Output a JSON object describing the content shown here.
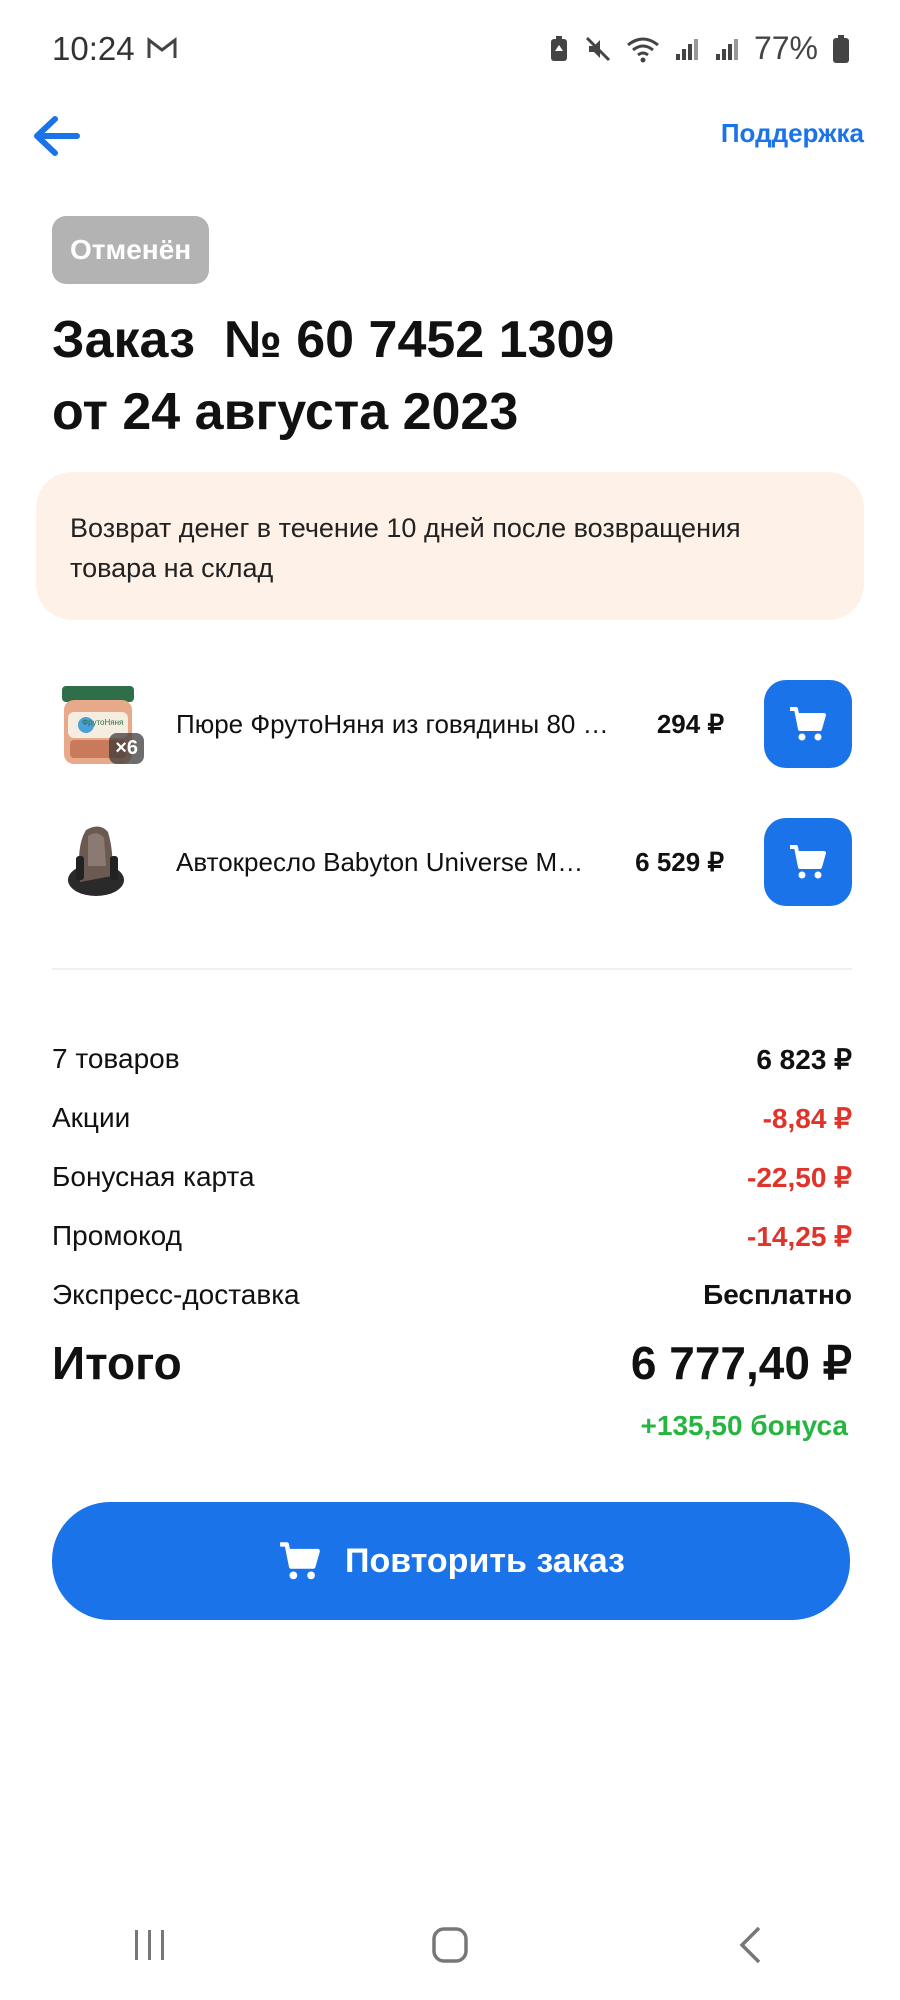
{
  "status_bar": {
    "time": "10:24",
    "battery": "77%"
  },
  "header": {
    "support_label": "Поддержка"
  },
  "order": {
    "status_badge": "Отменён",
    "title_line1": "Заказ  № 60 7452 1309",
    "title_line2": "от 24 августа 2023"
  },
  "banner": {
    "text": "Возврат денег в течение 10 дней после возвращения товара на склад"
  },
  "products": [
    {
      "name": "Пюре ФрутоНяня из говядины 80 …",
      "price": "294 ₽",
      "quantity_badge": "×6",
      "thumb_label": "ФрутоНяня"
    },
    {
      "name": "Автокресло Babyton Universe M…",
      "price": "6 529 ₽"
    }
  ],
  "summary": {
    "rows": [
      {
        "label": "7 товаров",
        "value": "6 823 ₽"
      },
      {
        "label": "Акции",
        "value": "-8,84 ₽"
      },
      {
        "label": "Бонусная карта",
        "value": "-22,50 ₽"
      },
      {
        "label": "Промокод",
        "value": "-14,25 ₽"
      },
      {
        "label": "Экспресс-доставка",
        "value": "Бесплатно"
      }
    ],
    "total_label": "Итого",
    "total_value": "6 777,40 ₽",
    "bonus": "+135,50 бонуса"
  },
  "actions": {
    "repeat_label": "Повторить заказ"
  },
  "colors": {
    "accent": "#1a73e8",
    "negative": "#e0332a",
    "bonus": "#27b541",
    "badge_bg": "#b3b3b3",
    "banner_bg": "#fdf1e8"
  }
}
